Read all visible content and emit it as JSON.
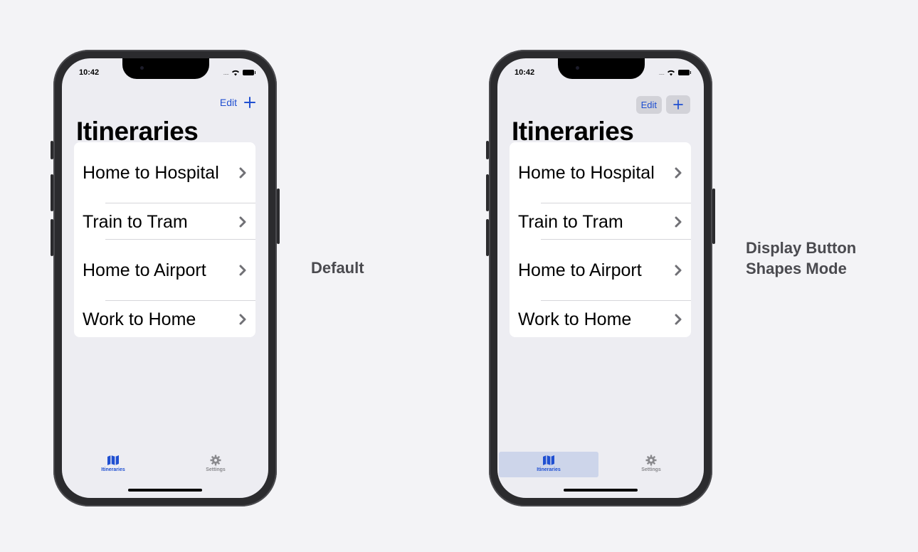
{
  "phones": [
    {
      "status": {
        "time": "10:42"
      },
      "nav": {
        "edit_label": "Edit",
        "add_icon": "plus-icon"
      },
      "title": "Itineraries",
      "items": [
        {
          "label": "Home to Hospital"
        },
        {
          "label": "Train to Tram"
        },
        {
          "label": "Home to Airport"
        },
        {
          "label": "Work to Home"
        }
      ],
      "tabs": [
        {
          "label": "Itineraries",
          "icon": "map-icon",
          "selected": true
        },
        {
          "label": "Settings",
          "icon": "gear-icon",
          "selected": false
        }
      ]
    },
    {
      "status": {
        "time": "10:42"
      },
      "nav": {
        "edit_label": "Edit",
        "add_icon": "plus-icon"
      },
      "title": "Itineraries",
      "items": [
        {
          "label": "Home to Hospital"
        },
        {
          "label": "Train to Tram"
        },
        {
          "label": "Home to Airport"
        },
        {
          "label": "Work to Home"
        }
      ],
      "tabs": [
        {
          "label": "Itineraries",
          "icon": "map-icon",
          "selected": true
        },
        {
          "label": "Settings",
          "icon": "gear-icon",
          "selected": false
        }
      ]
    }
  ],
  "captions": {
    "default": "Default",
    "button_shapes": "Display Button Shapes Mode"
  },
  "colors": {
    "accent": "#1f4fd1",
    "background": "#f3f3f6",
    "screen": "#ededf2",
    "button_shape_fill": "#d2d2d8",
    "tab_highlight": "#cdd5ea"
  }
}
